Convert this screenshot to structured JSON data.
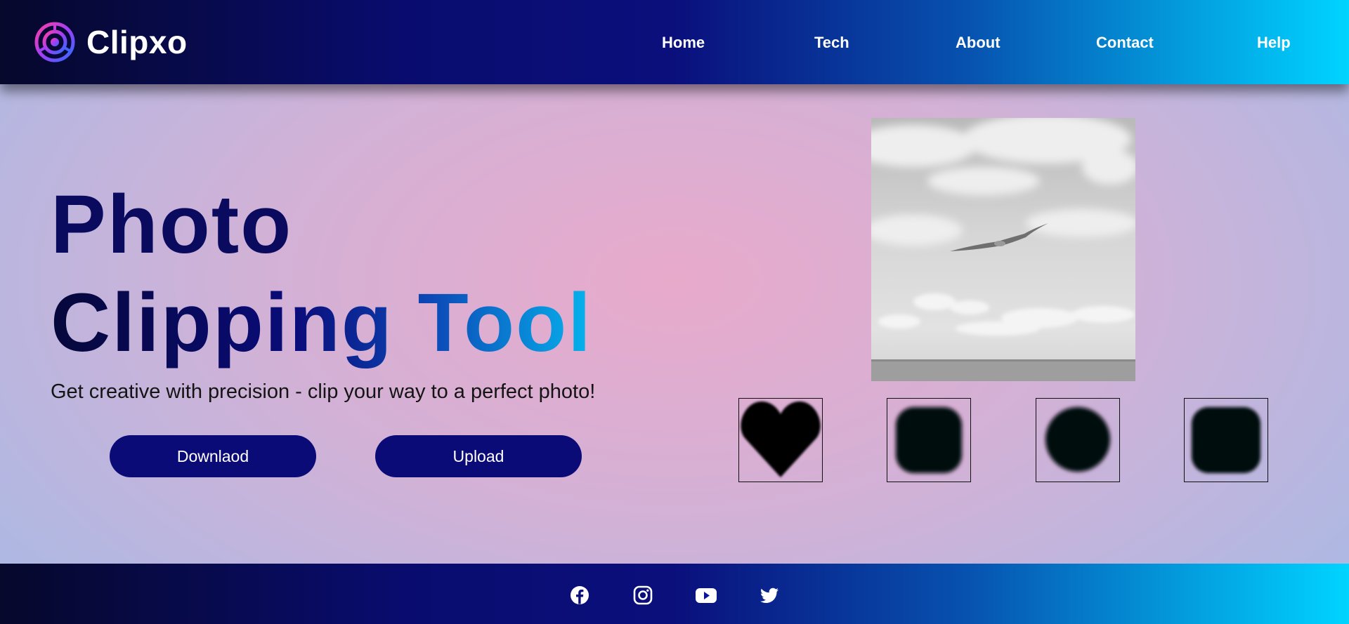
{
  "brand": {
    "name": "Clipxo",
    "logo_icon": "aperture-logo-icon"
  },
  "nav": {
    "items": [
      {
        "label": "Home"
      },
      {
        "label": "Tech"
      },
      {
        "label": "About"
      },
      {
        "label": "Contact"
      },
      {
        "label": "Help"
      }
    ]
  },
  "hero": {
    "title_line1": "Photo",
    "title_line2": "Clipping Tool",
    "subtitle": "Get creative with precision - clip your way to a perfect photo!",
    "download_label": "Downlaod",
    "upload_label": "Upload"
  },
  "preview": {
    "subject": "grayscale-sky-bird-image"
  },
  "shapes": [
    {
      "name": "heart-shape-icon"
    },
    {
      "name": "rounded-square-shape-icon"
    },
    {
      "name": "circle-shape-icon"
    },
    {
      "name": "rounded-square-shape-icon-2"
    }
  ],
  "footer": {
    "social": [
      "facebook-icon",
      "instagram-icon",
      "youtube-icon",
      "twitter-icon"
    ]
  },
  "colors": {
    "nav_start": "#06082c",
    "nav_mid": "#0a0f7c",
    "nav_end": "#00d4ff",
    "button": "#0b0b78",
    "title": "#0a0b5e",
    "title_accent": "#06b4ee",
    "bg_center": "#e8aacb",
    "bg_edge": "#9dbce9"
  }
}
